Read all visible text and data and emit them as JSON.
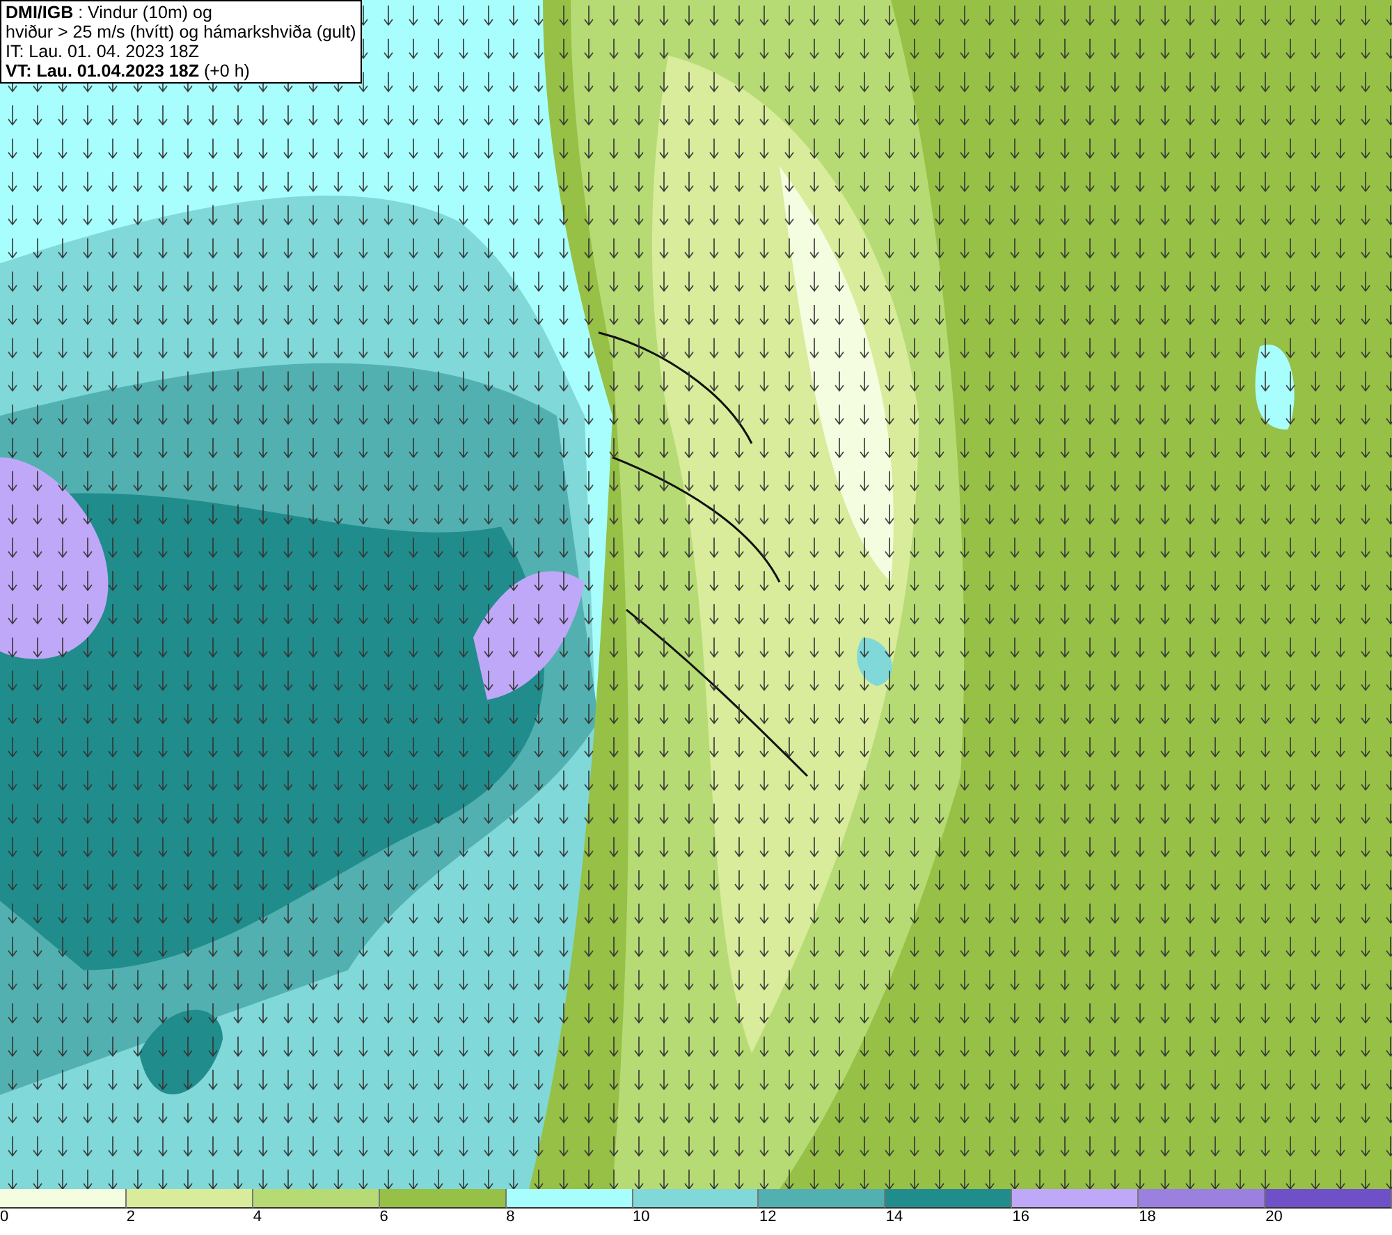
{
  "header": {
    "lines": [
      "**DMI/IGB** : Vindur (10m) og",
      "hviður > 25 m/s (hvítt) og hámarkshviða (gult)",
      "IT: Lau. 01. 04. 2023 18Z",
      "**VT: Lau. 01.04.2023 18Z** (+0 h)"
    ]
  },
  "legend": {
    "bins": [
      {
        "color": "#f5fde0",
        "label": "0"
      },
      {
        "color": "#d8ec9c",
        "label": "2"
      },
      {
        "color": "#b6db74",
        "label": "4"
      },
      {
        "color": "#96c046",
        "label": "6"
      },
      {
        "color": "#a8fdfd",
        "label": "8"
      },
      {
        "color": "#80d8d8",
        "label": "10"
      },
      {
        "color": "#52b0b0",
        "label": "12"
      },
      {
        "color": "#218c8c",
        "label": "14"
      },
      {
        "color": "#c0a8f8",
        "label": "16"
      },
      {
        "color": "#9c80e0",
        "label": "18"
      },
      {
        "color": "#7050c8",
        "label": "20"
      }
    ]
  }
}
